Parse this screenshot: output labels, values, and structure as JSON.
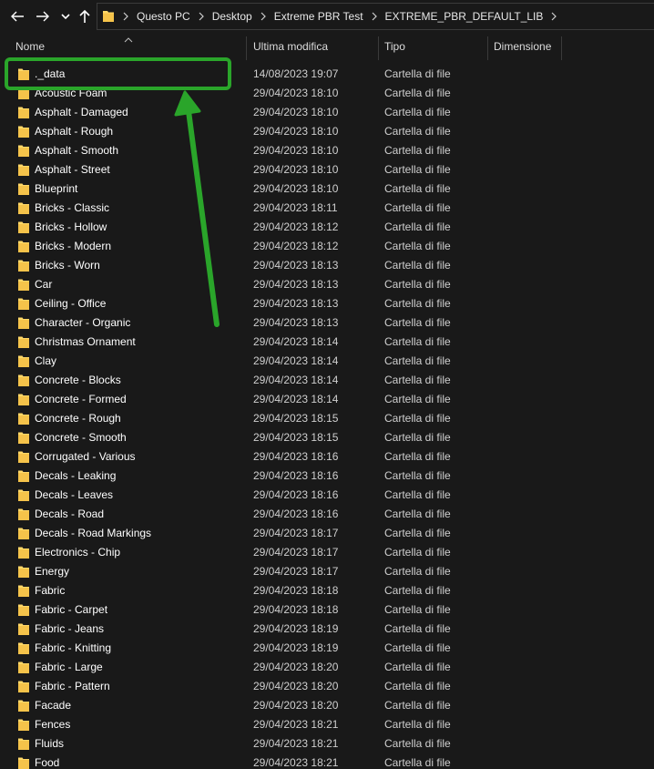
{
  "breadcrumb": [
    "Questo PC",
    "Desktop",
    "Extreme PBR Test",
    "EXTREME_PBR_DEFAULT_LIB"
  ],
  "columns": {
    "name": "Nome",
    "date": "Ultima modifica",
    "type": "Tipo",
    "size": "Dimensione"
  },
  "colors": {
    "background": "#191919",
    "folder": "#ffd868",
    "annotation": "#2aa52a"
  },
  "icons": [
    "back-arrow-icon",
    "forward-arrow-icon",
    "chevron-down-icon",
    "up-arrow-icon",
    "folder-icon",
    "chevron-right-icon",
    "sort-up-icon"
  ],
  "files": [
    {
      "name": "._data",
      "date": "14/08/2023 19:07",
      "type": "Cartella di file"
    },
    {
      "name": "Acoustic Foam",
      "date": "29/04/2023 18:10",
      "type": "Cartella di file"
    },
    {
      "name": "Asphalt - Damaged",
      "date": "29/04/2023 18:10",
      "type": "Cartella di file"
    },
    {
      "name": "Asphalt - Rough",
      "date": "29/04/2023 18:10",
      "type": "Cartella di file"
    },
    {
      "name": "Asphalt - Smooth",
      "date": "29/04/2023 18:10",
      "type": "Cartella di file"
    },
    {
      "name": "Asphalt - Street",
      "date": "29/04/2023 18:10",
      "type": "Cartella di file"
    },
    {
      "name": "Blueprint",
      "date": "29/04/2023 18:10",
      "type": "Cartella di file"
    },
    {
      "name": "Bricks - Classic",
      "date": "29/04/2023 18:11",
      "type": "Cartella di file"
    },
    {
      "name": "Bricks - Hollow",
      "date": "29/04/2023 18:12",
      "type": "Cartella di file"
    },
    {
      "name": "Bricks - Modern",
      "date": "29/04/2023 18:12",
      "type": "Cartella di file"
    },
    {
      "name": "Bricks - Worn",
      "date": "29/04/2023 18:13",
      "type": "Cartella di file"
    },
    {
      "name": "Car",
      "date": "29/04/2023 18:13",
      "type": "Cartella di file"
    },
    {
      "name": "Ceiling - Office",
      "date": "29/04/2023 18:13",
      "type": "Cartella di file"
    },
    {
      "name": "Character - Organic",
      "date": "29/04/2023 18:13",
      "type": "Cartella di file"
    },
    {
      "name": "Christmas Ornament",
      "date": "29/04/2023 18:14",
      "type": "Cartella di file"
    },
    {
      "name": "Clay",
      "date": "29/04/2023 18:14",
      "type": "Cartella di file"
    },
    {
      "name": "Concrete - Blocks",
      "date": "29/04/2023 18:14",
      "type": "Cartella di file"
    },
    {
      "name": "Concrete - Formed",
      "date": "29/04/2023 18:14",
      "type": "Cartella di file"
    },
    {
      "name": "Concrete - Rough",
      "date": "29/04/2023 18:15",
      "type": "Cartella di file"
    },
    {
      "name": "Concrete - Smooth",
      "date": "29/04/2023 18:15",
      "type": "Cartella di file"
    },
    {
      "name": "Corrugated - Various",
      "date": "29/04/2023 18:16",
      "type": "Cartella di file"
    },
    {
      "name": "Decals - Leaking",
      "date": "29/04/2023 18:16",
      "type": "Cartella di file"
    },
    {
      "name": "Decals - Leaves",
      "date": "29/04/2023 18:16",
      "type": "Cartella di file"
    },
    {
      "name": "Decals - Road",
      "date": "29/04/2023 18:16",
      "type": "Cartella di file"
    },
    {
      "name": "Decals - Road Markings",
      "date": "29/04/2023 18:17",
      "type": "Cartella di file"
    },
    {
      "name": "Electronics - Chip",
      "date": "29/04/2023 18:17",
      "type": "Cartella di file"
    },
    {
      "name": "Energy",
      "date": "29/04/2023 18:17",
      "type": "Cartella di file"
    },
    {
      "name": "Fabric",
      "date": "29/04/2023 18:18",
      "type": "Cartella di file"
    },
    {
      "name": "Fabric - Carpet",
      "date": "29/04/2023 18:18",
      "type": "Cartella di file"
    },
    {
      "name": "Fabric - Jeans",
      "date": "29/04/2023 18:19",
      "type": "Cartella di file"
    },
    {
      "name": "Fabric - Knitting",
      "date": "29/04/2023 18:19",
      "type": "Cartella di file"
    },
    {
      "name": "Fabric - Large",
      "date": "29/04/2023 18:20",
      "type": "Cartella di file"
    },
    {
      "name": "Fabric - Pattern",
      "date": "29/04/2023 18:20",
      "type": "Cartella di file"
    },
    {
      "name": "Facade",
      "date": "29/04/2023 18:20",
      "type": "Cartella di file"
    },
    {
      "name": "Fences",
      "date": "29/04/2023 18:21",
      "type": "Cartella di file"
    },
    {
      "name": "Fluids",
      "date": "29/04/2023 18:21",
      "type": "Cartella di file"
    },
    {
      "name": "Food",
      "date": "29/04/2023 18:21",
      "type": "Cartella di file"
    }
  ]
}
